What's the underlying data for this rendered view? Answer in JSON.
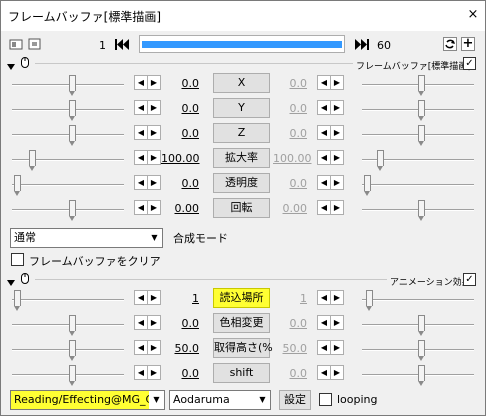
{
  "window": {
    "title": "フレームバッファ[標準描画]",
    "close_glyph": "×"
  },
  "timeline": {
    "start": "1",
    "end": "60",
    "prev_glyph": "◀◀",
    "next_glyph": "▶▶"
  },
  "section1": {
    "title": "フレームバッファ[標準描画]",
    "rows": [
      {
        "left": "0.0",
        "label": "X",
        "right": "0.0"
      },
      {
        "left": "0.0",
        "label": "Y",
        "right": "0.0"
      },
      {
        "left": "0.0",
        "label": "Z",
        "right": "0.0"
      },
      {
        "left": "100.00",
        "label": "拡大率",
        "right": "100.00"
      },
      {
        "left": "0.0",
        "label": "透明度",
        "right": "0.0"
      },
      {
        "left": "0.00",
        "label": "回転",
        "right": "0.00"
      }
    ],
    "blend_value": "通常",
    "blend_label": "合成モード",
    "clear_label": "フレームバッファをクリア"
  },
  "section2": {
    "title": "アニメーション効果",
    "rows": [
      {
        "left": "1",
        "label": "読込場所",
        "right": "1"
      },
      {
        "left": "0.0",
        "label": "色相変更",
        "right": "0.0"
      },
      {
        "left": "50.0",
        "label": "取得高さ(%",
        "right": "50.0"
      },
      {
        "left": "0.0",
        "label": "shift",
        "right": "0.0"
      }
    ],
    "effect_value": "Reading/Effecting@MG_C",
    "preset_value": "Aodaruma",
    "settings_label": "設定",
    "looping_label": "looping"
  },
  "spin": {
    "dec": "◀",
    "inc": "▶"
  },
  "colors": {
    "highlight": "#ffff33",
    "timeline_bar": "#3399ff"
  }
}
